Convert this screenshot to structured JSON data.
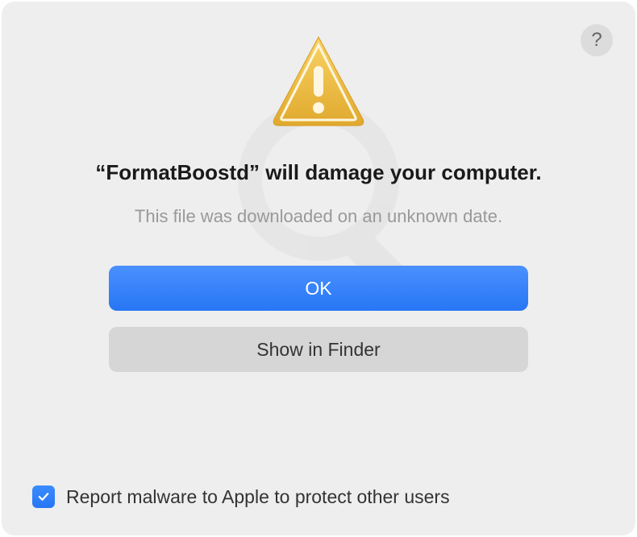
{
  "help": {
    "label": "?"
  },
  "alert": {
    "title": "“FormatBoostd” will damage your computer.",
    "subtitle": "This file was downloaded on an unknown date."
  },
  "buttons": {
    "primary": "OK",
    "secondary": "Show in Finder"
  },
  "checkbox": {
    "checked": true,
    "label": "Report malware to Apple to protect other users"
  }
}
